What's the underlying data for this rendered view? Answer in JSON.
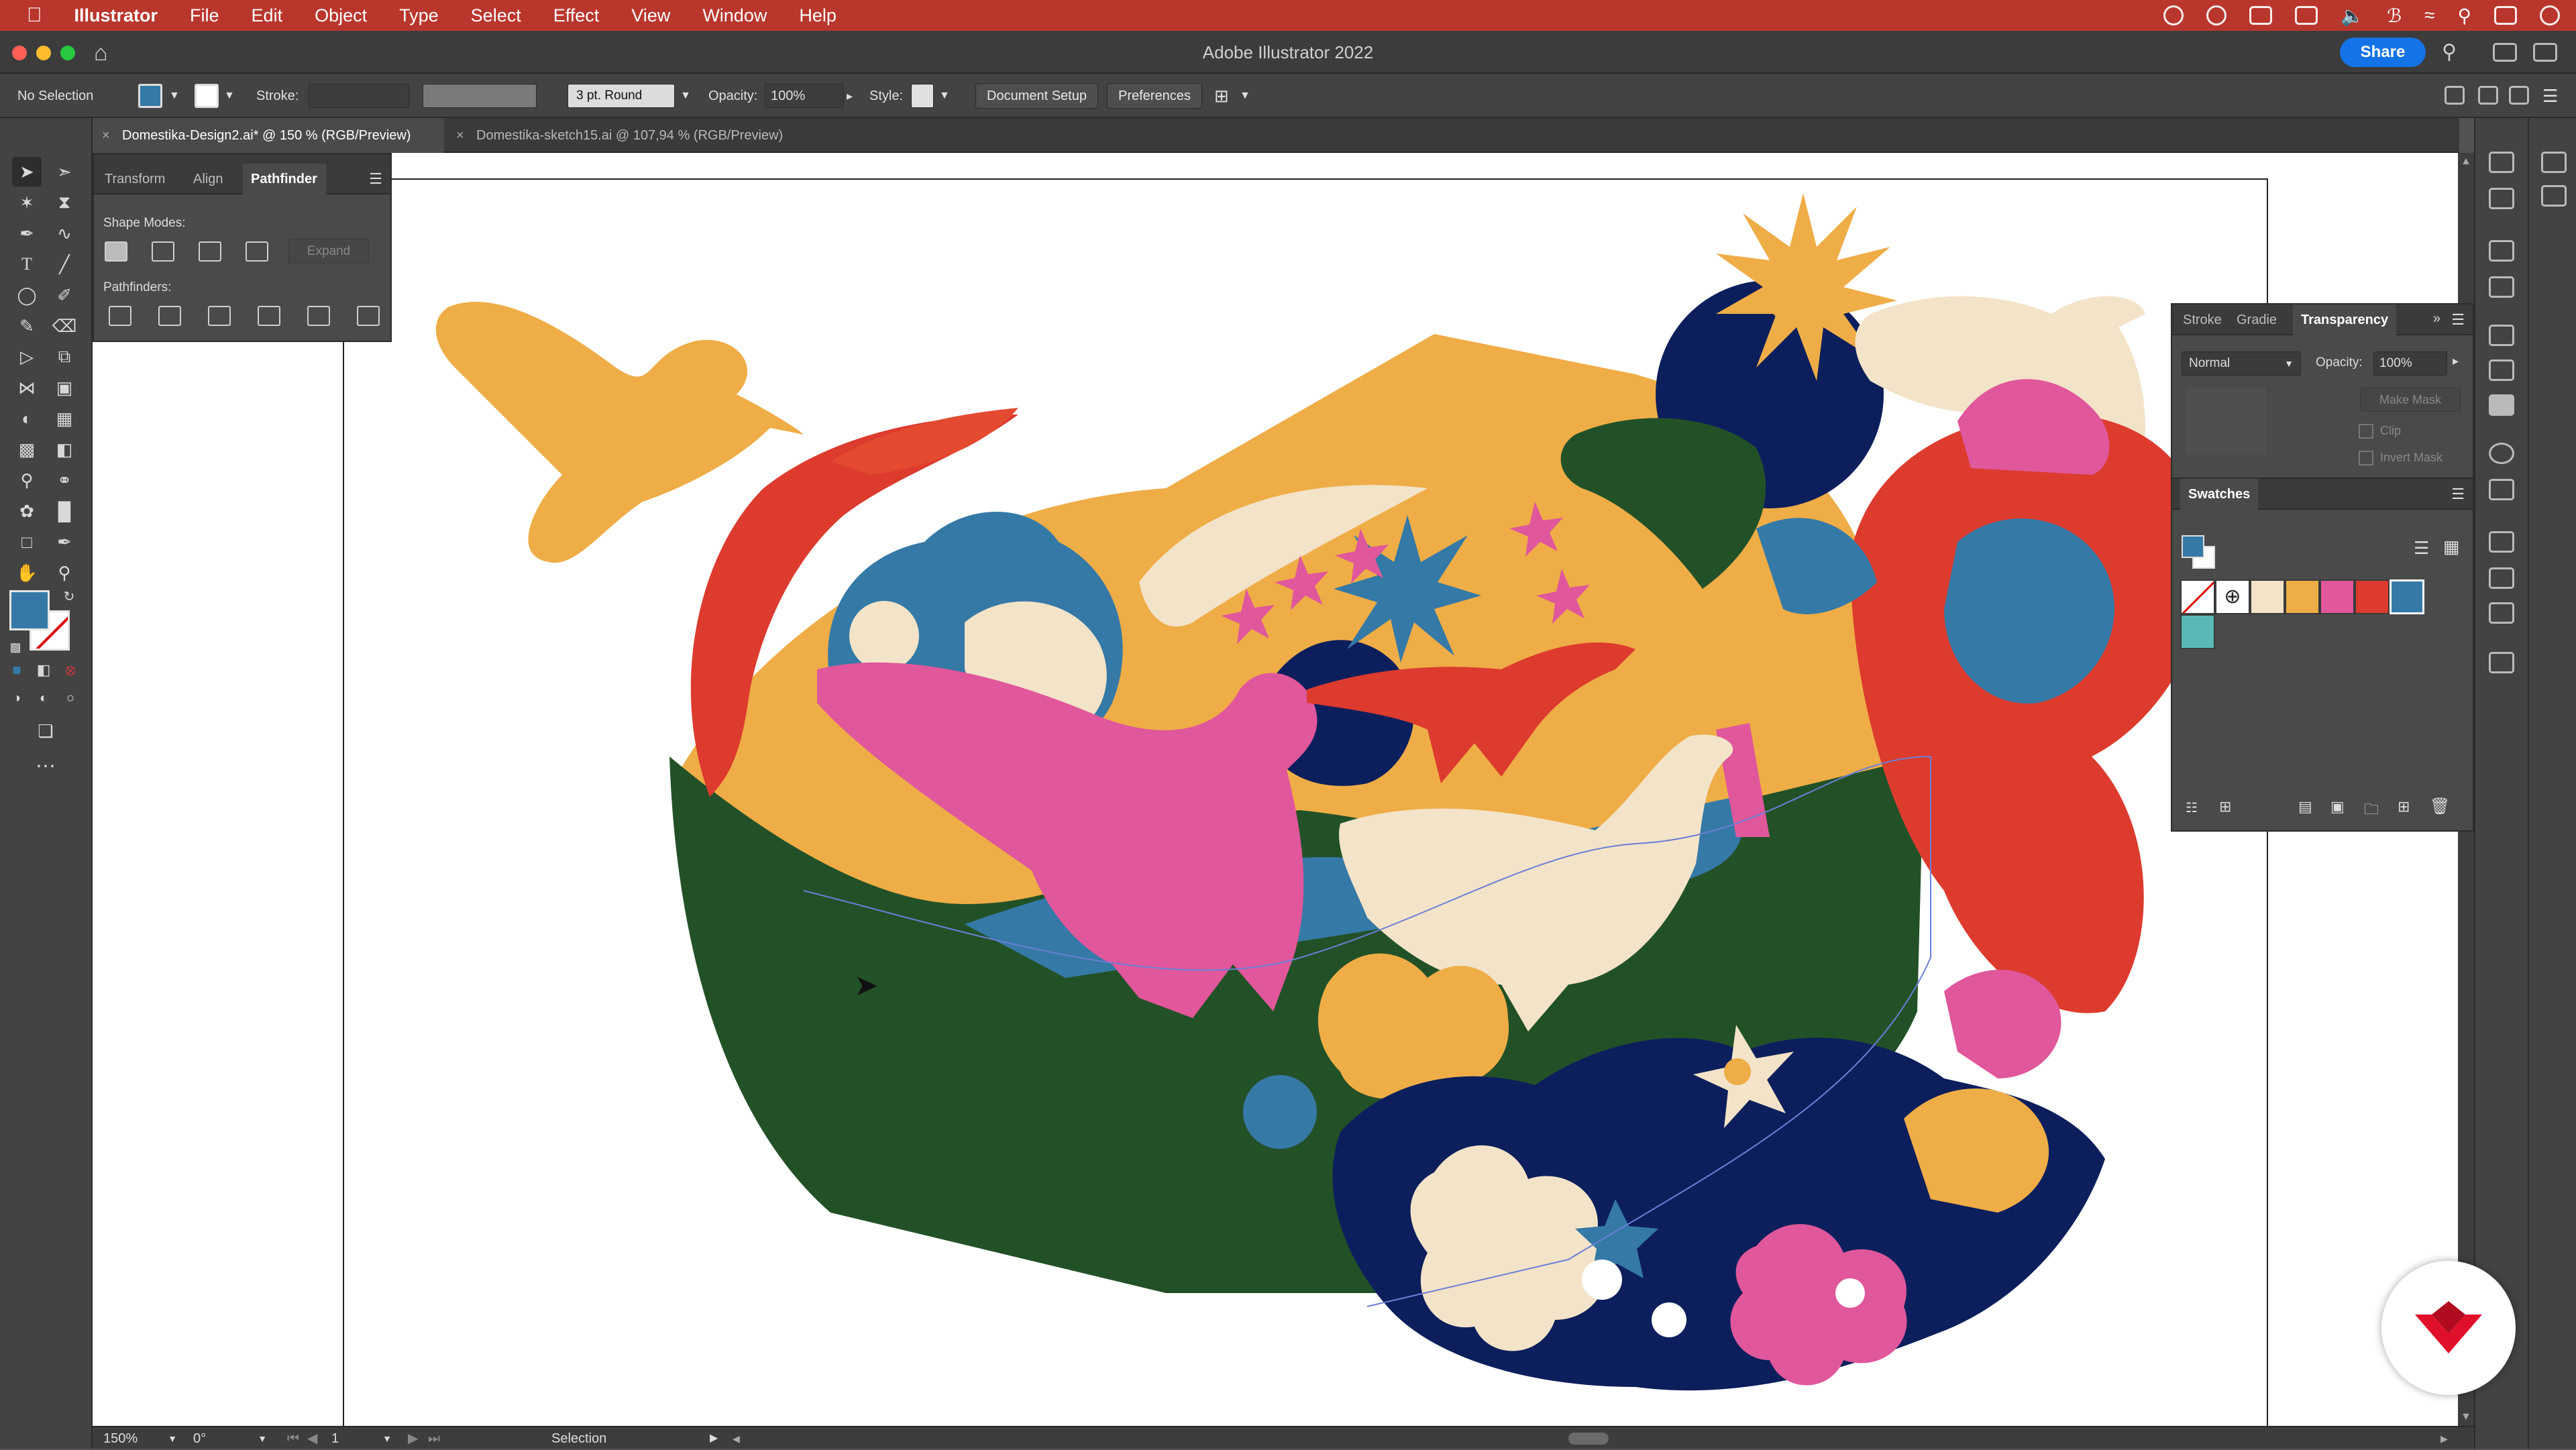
{
  "menubar": {
    "apple_icon": "apple-icon",
    "app_name": "Illustrator",
    "items": [
      "File",
      "Edit",
      "Object",
      "Type",
      "Select",
      "Effect",
      "View",
      "Window",
      "Help"
    ]
  },
  "titlebar": {
    "title": "Adobe Illustrator 2022",
    "share_label": "Share"
  },
  "controlbar": {
    "selection": "No Selection",
    "stroke_label": "Stroke:",
    "brush": "3 pt. Round",
    "opacity_label": "Opacity:",
    "opacity_value": "100%",
    "style_label": "Style:",
    "document_setup": "Document Setup",
    "preferences": "Preferences"
  },
  "tabs": [
    {
      "label": "Domestika-Design2.ai* @ 150 % (RGB/Preview)",
      "close": "×"
    },
    {
      "label": "Domestika-sketch15.ai @ 107,94 % (RGB/Preview)",
      "close": "×"
    }
  ],
  "pathfinder_panel": {
    "tabs": [
      "Transform",
      "Align",
      "Pathfinder"
    ],
    "active_tab": "Pathfinder",
    "shape_modes_label": "Shape Modes:",
    "expand_label": "Expand",
    "pathfinders_label": "Pathfinders:"
  },
  "transparency_panel": {
    "tabs": [
      "Stroke",
      "Gradie",
      "Transparency"
    ],
    "active_tab": "Transparency",
    "blend_mode": "Normal",
    "opacity_label": "Opacity:",
    "opacity_value": "100%",
    "make_mask": "Make Mask",
    "clip_label": "Clip",
    "invert_mask_label": "Invert Mask"
  },
  "swatches_panel": {
    "title": "Swatches",
    "colors": [
      "none",
      "registration",
      "#f3e3c8",
      "#efad47",
      "#e0579b",
      "#dc3b2e",
      "#3579a6",
      "#5ab9b5"
    ]
  },
  "statusbar": {
    "zoom": "150%",
    "rotation": "0°",
    "artboard_number": "1",
    "tool": "Selection"
  },
  "colors": {
    "fill": "#3579a6",
    "menubar": "#b9362d",
    "accent": "#1473e6",
    "orange": "#efad47",
    "green": "#235127",
    "pink": "#e0579b",
    "red": "#dc3b2e",
    "blue": "#3579a6",
    "navy": "#0c1f5c",
    "cream": "#f3e3c8"
  }
}
